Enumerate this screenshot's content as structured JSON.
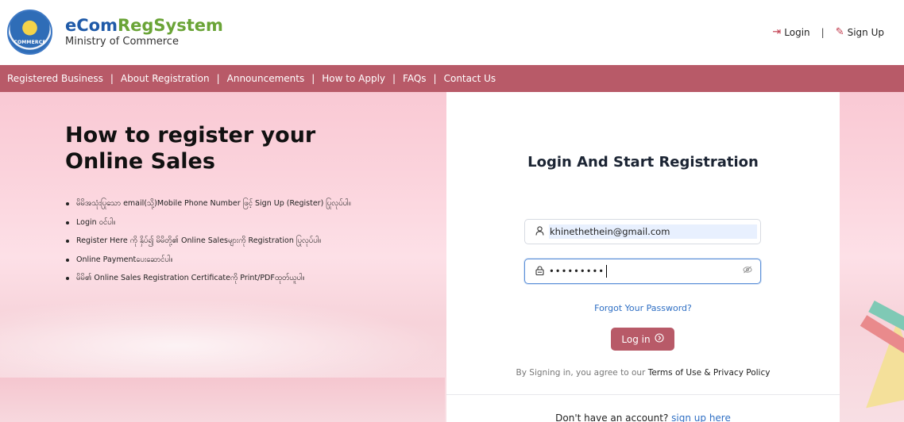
{
  "header": {
    "brand_prefix": "eCom",
    "brand_suffix": "RegSystem",
    "brand_sub": "Ministry of Commerce",
    "seal_text": "COMMERCE",
    "login_label": "Login",
    "signup_label": "Sign Up",
    "separator": "|"
  },
  "menu": {
    "items": [
      "Registered Business",
      "About Registration",
      "Announcements",
      "How to Apply",
      "FAQs",
      "Contact Us"
    ],
    "separator": "|"
  },
  "hero": {
    "title": "How to register your Online Sales",
    "steps": [
      "မိမိအသုံးပြုသော email(သို့)Mobile Phone Number ဖြင့် Sign Up (Register) ပြုလုပ်ပါ။",
      "Login ဝင်ပါ။",
      "Register Here ကို နှိပ်၍ မိမိတို့၏ Online Salesများကို Registration ပြုလုပ်ပါ။",
      "Online Paymentပေးဆောင်ပါ။",
      "မိမိ၏ Online Sales Registration Certificateကို Print/PDFထုတ်ယူပါ။"
    ]
  },
  "login": {
    "title": "Login And Start Registration",
    "email_value": "khinethethein@gmail.com",
    "password_mask": "•••••••••",
    "forgot_label": "Forgot Your Password?",
    "login_button": "Log in",
    "agree_prefix": "By Signing in, you agree to our ",
    "agree_terms": "Terms of Use & Privacy Policy",
    "no_account_prefix": "Don't have an account? ",
    "signup_link": "sign up here"
  },
  "colors": {
    "brand_blue": "#1f5aa8",
    "brand_green": "#6aa437",
    "menu_bg": "#b85a68",
    "link_blue": "#2f6fc4"
  },
  "icons": {
    "login": "login-icon",
    "signup": "edit-icon",
    "user": "user-icon",
    "lock": "lock-icon",
    "eye": "eye-off-icon",
    "arrow": "arrow-right-circle-icon"
  }
}
